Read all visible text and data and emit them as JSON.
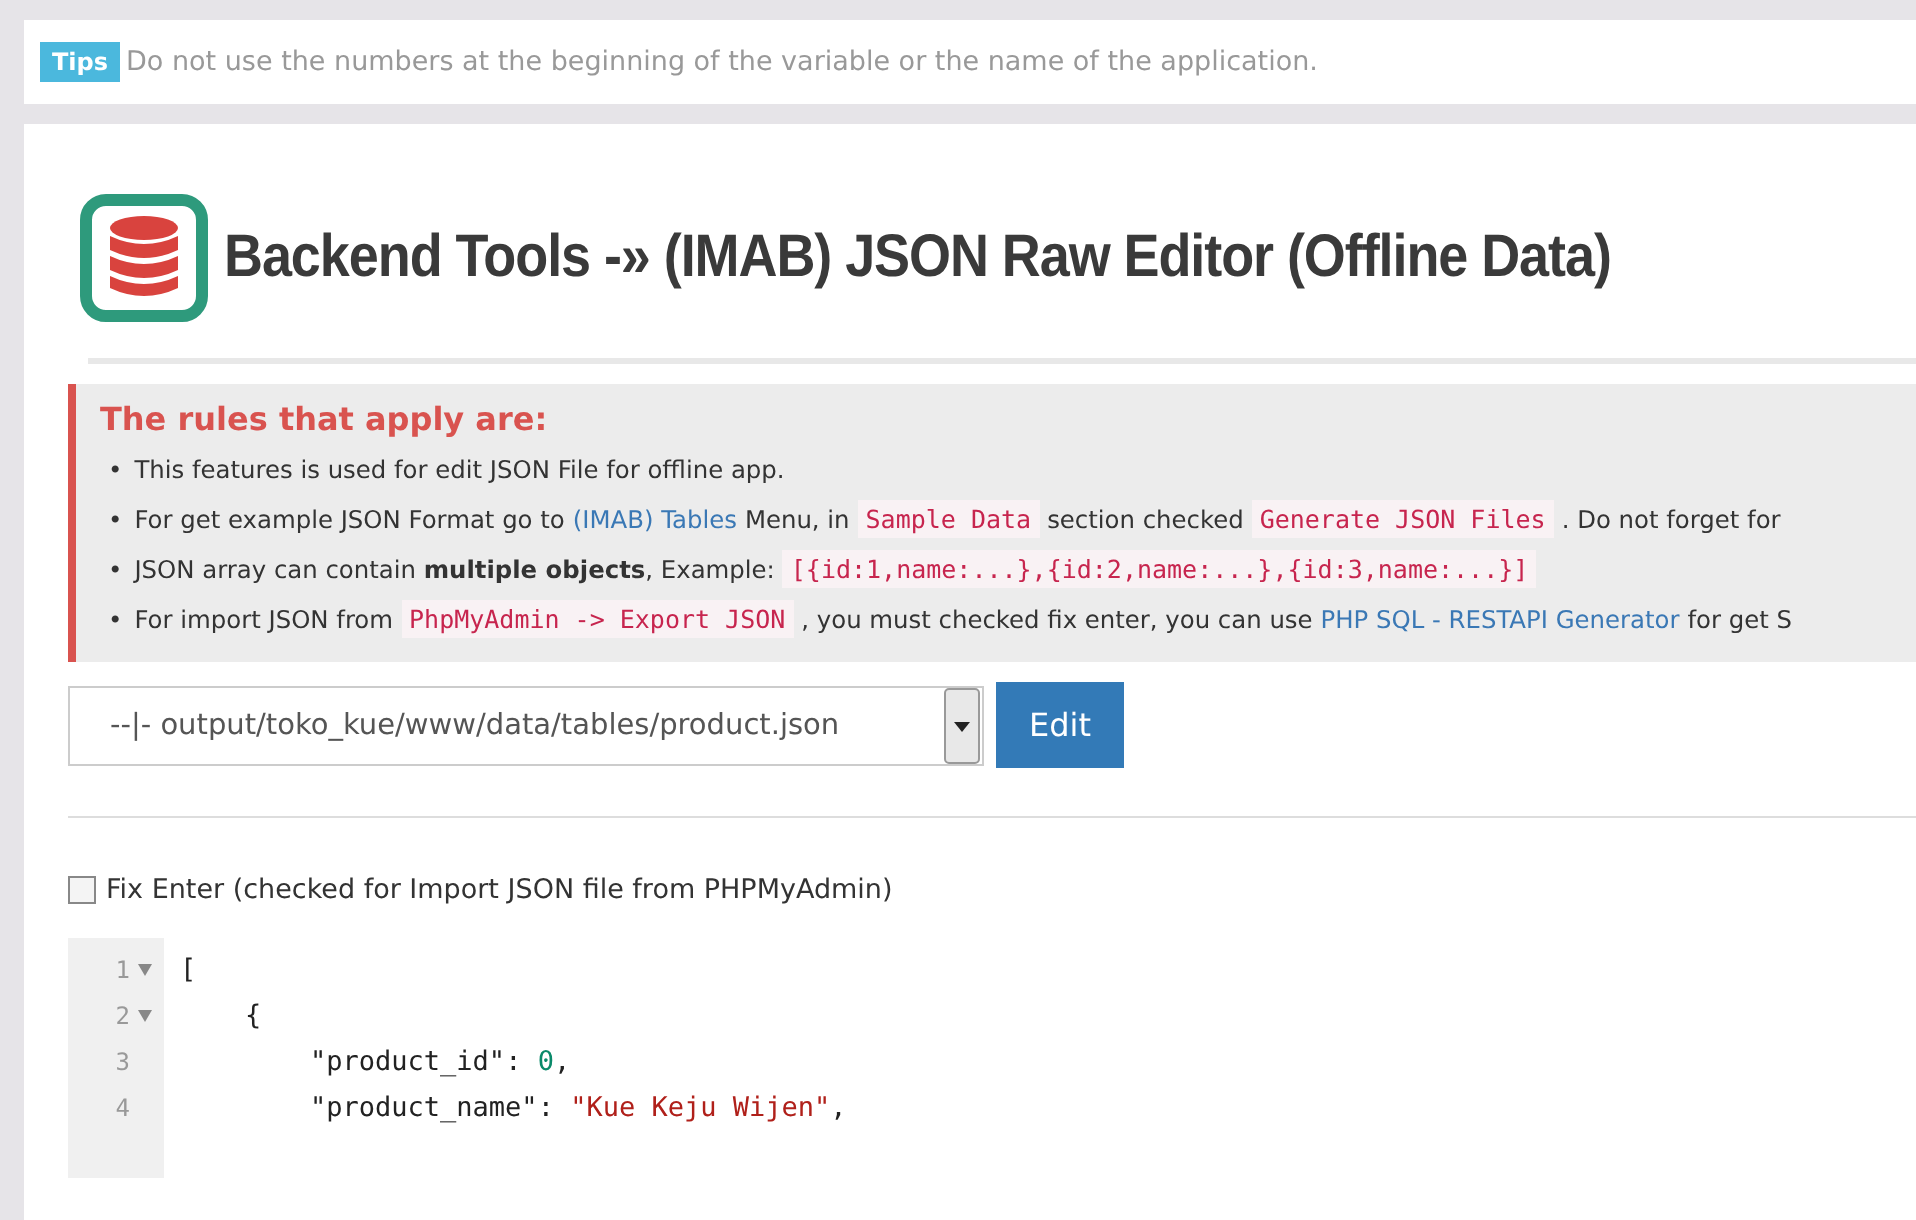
{
  "tips": {
    "badge": "Tips",
    "text": "Do not use the numbers at the beginning of the variable or the name of the application."
  },
  "title": "Backend Tools -» (IMAB) JSON Raw Editor (Offline Data)",
  "rules": {
    "heading": "The rules that apply are:",
    "items": [
      {
        "bullet": "•",
        "segments": [
          {
            "kind": "text",
            "text": "This features is used for edit JSON File for offline app."
          }
        ]
      },
      {
        "bullet": "•",
        "segments": [
          {
            "kind": "text",
            "text": "For get example JSON Format go to"
          },
          {
            "kind": "link",
            "text": "(IMAB) Tables"
          },
          {
            "kind": "text",
            "text": "Menu, in"
          },
          {
            "kind": "code",
            "text": "Sample Data"
          },
          {
            "kind": "text",
            "text": "section checked"
          },
          {
            "kind": "code",
            "text": "Generate JSON Files"
          },
          {
            "kind": "text",
            "text": ". Do not forget for"
          }
        ]
      },
      {
        "bullet": "•",
        "segments": [
          {
            "kind": "rich",
            "text": "JSON array can contain **multiple objects**, Example:"
          },
          {
            "kind": "code",
            "text": "[{id:1,name:...},{id:2,name:...},{id:3,name:...}]"
          }
        ]
      },
      {
        "bullet": "•",
        "segments": [
          {
            "kind": "text",
            "text": "For import JSON from"
          },
          {
            "kind": "code",
            "text": "PhpMyAdmin -> Export JSON"
          },
          {
            "kind": "text",
            "text": ", you must checked fix enter, you can use"
          },
          {
            "kind": "link",
            "text": "PHP SQL - RESTAPI Generator"
          },
          {
            "kind": "text",
            "text": "for get S"
          }
        ]
      }
    ]
  },
  "file_select": {
    "value": "--|- output/toko_kue/www/data/tables/product.json"
  },
  "edit_button": "Edit",
  "fix_enter": {
    "label": "Fix Enter (checked for Import JSON file from PHPMyAdmin)",
    "checked": false
  },
  "editor": {
    "lines": [
      {
        "number": "1",
        "fold": true,
        "tokens": [
          {
            "kind": "plain",
            "text": "["
          }
        ]
      },
      {
        "number": "2",
        "fold": true,
        "tokens": [
          {
            "kind": "plain",
            "text": "    {"
          }
        ]
      },
      {
        "number": "3",
        "fold": false,
        "tokens": [
          {
            "kind": "key",
            "text": "        \"product_id\""
          },
          {
            "kind": "plain",
            "text": ": "
          },
          {
            "kind": "number",
            "text": "0"
          },
          {
            "kind": "plain",
            "text": ","
          }
        ]
      },
      {
        "number": "4",
        "fold": false,
        "tokens": [
          {
            "kind": "key",
            "text": "        \"product_name\""
          },
          {
            "kind": "plain",
            "text": ": "
          },
          {
            "kind": "string",
            "text": "\"Kue Keju Wijen\""
          },
          {
            "kind": "plain",
            "text": ","
          }
        ]
      }
    ]
  }
}
